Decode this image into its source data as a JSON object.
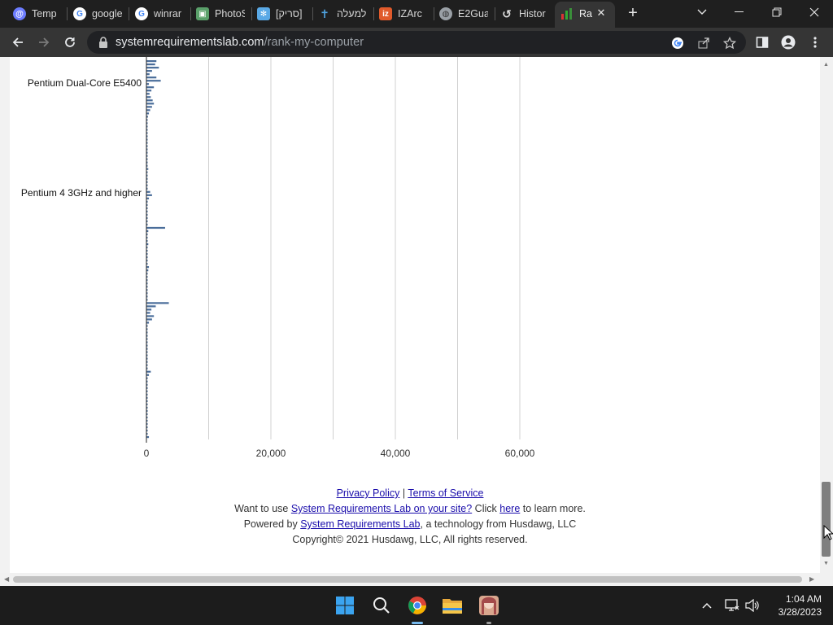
{
  "tabs": [
    {
      "title": "Temp M",
      "icon": "mail-icon",
      "color": "#6c7cff"
    },
    {
      "title": "google",
      "icon": "google-icon",
      "color": "#ffffff"
    },
    {
      "title": "winrar",
      "icon": "google-icon",
      "color": "#ffffff"
    },
    {
      "title": "PhotoS",
      "icon": "photo-app-icon",
      "color": "#5aa06a"
    },
    {
      "title": "[סריק]",
      "icon": "snowflake-icon",
      "color": "#5aa9e6"
    },
    {
      "title": "למעלה",
      "icon": "dagger-icon",
      "color": "#4fa3e0"
    },
    {
      "title": "IZArc",
      "icon": "izarc-icon",
      "color": "#e05a2b"
    },
    {
      "title": "E2Gua",
      "icon": "globe-icon",
      "color": "#9aa0a6"
    },
    {
      "title": "Histor",
      "icon": "history-icon",
      "color": "#e0e0e0"
    },
    {
      "title": "Ra",
      "icon": "srl-icon",
      "color": "#3a8f3a"
    }
  ],
  "address": {
    "host": "systemrequirementslab.com",
    "path": "/rank-my-computer"
  },
  "chart_data": {
    "type": "bar",
    "orientation": "horizontal",
    "visible_category_labels": [
      "Pentium Dual-Core E5400",
      "Pentium 4 3GHz and higher"
    ],
    "x_ticks": [
      0,
      20000,
      40000,
      60000
    ],
    "x_tick_labels": [
      "0",
      "20,000",
      "40,000",
      "60,000"
    ],
    "xlim": [
      0,
      72000
    ],
    "gridlines": true,
    "bar_color": "#4a6d9a",
    "bar_values": [
      1600,
      1400,
      2000,
      900,
      500,
      1600,
      2300,
      400,
      1200,
      800,
      500,
      700,
      1000,
      1200,
      900,
      600,
      400,
      250,
      180,
      150,
      120,
      100,
      100,
      100,
      100,
      80,
      80,
      80,
      80,
      80,
      80,
      80,
      80,
      300,
      100,
      100,
      100,
      100,
      80,
      80,
      600,
      900,
      400,
      200,
      100,
      100,
      100,
      80,
      80,
      80,
      100,
      3000,
      300,
      200,
      100,
      100,
      300,
      100,
      100,
      100,
      100,
      100,
      80,
      400,
      300,
      200,
      100,
      80,
      80,
      80,
      80,
      80,
      80,
      100,
      3600,
      1500,
      800,
      600,
      1200,
      900,
      400,
      200,
      100,
      100,
      100,
      80,
      80,
      80,
      80,
      100,
      80,
      80,
      80,
      80,
      100,
      700,
      400,
      200,
      100,
      80,
      80,
      80,
      80,
      80,
      80,
      80,
      80,
      80,
      80,
      80,
      80,
      80,
      80,
      80,
      100,
      400
    ]
  },
  "footer": {
    "privacy": "Privacy Policy",
    "sep": "|",
    "terms": "Terms of Service",
    "line2_pre": "Want to use",
    "line2_link": "System Requirements Lab on your site?",
    "line2_mid": "Click",
    "line2_here": "here",
    "line2_post": "to learn more.",
    "line3_pre": "Powered by",
    "line3_link": "System Requirements Lab",
    "line3_post": ", a technology from Husdawg, LLC",
    "copyright": "Copyright© 2021 Husdawg, LLC, All rights reserved."
  },
  "clock": {
    "time": "1:04 AM",
    "date": "3/28/2023"
  }
}
